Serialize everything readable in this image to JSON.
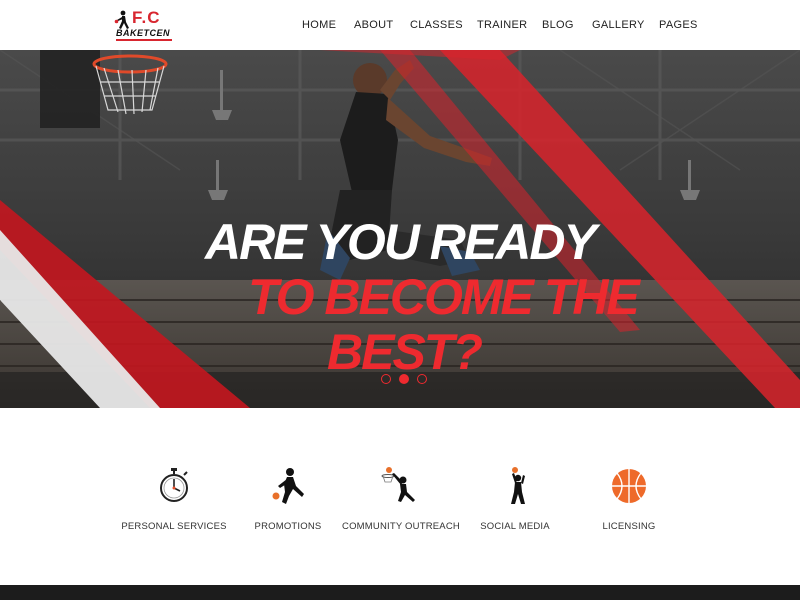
{
  "brand": {
    "logo_initials": "F.C",
    "logo_name": "BAKETCEN",
    "accent_color": "#ee2a2f"
  },
  "nav": {
    "items": [
      {
        "label": "HOME"
      },
      {
        "label": "ABOUT"
      },
      {
        "label": "CLASSES"
      },
      {
        "label": "TRAINER"
      },
      {
        "label": "BLOG"
      },
      {
        "label": "GALLERY"
      },
      {
        "label": "PAGES"
      }
    ]
  },
  "hero": {
    "line1": "ARE YOU READY",
    "line2": "TO BECOME THE",
    "line3": "BEST?",
    "slide_count": 3,
    "active_slide": 2
  },
  "features": [
    {
      "label": "PERSONAL SERVICES",
      "icon": "stopwatch-icon"
    },
    {
      "label": "PROMOTIONS",
      "icon": "dribbling-player-icon"
    },
    {
      "label": "COMMUNITY OUTREACH",
      "icon": "dunking-player-icon"
    },
    {
      "label": "SOCIAL MEDIA",
      "icon": "shooting-player-icon"
    },
    {
      "label": "LICENSING",
      "icon": "basketball-icon"
    }
  ]
}
